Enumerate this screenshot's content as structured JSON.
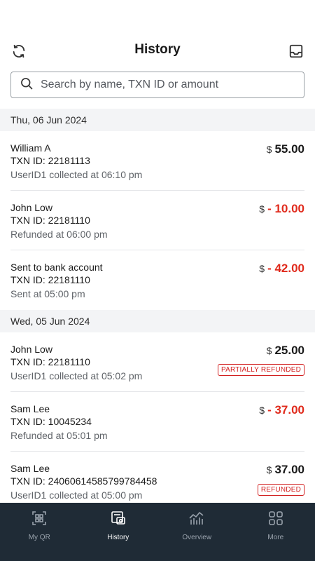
{
  "header": {
    "title": "History",
    "refresh_icon": "refresh-icon",
    "inbox_icon": "inbox-icon"
  },
  "search": {
    "placeholder": "Search by name, TXN ID or amount",
    "value": ""
  },
  "groups": [
    {
      "date": "Thu, 06 Jun 2024",
      "transactions": [
        {
          "name": "William A",
          "txn_id": "TXN ID: 22181113",
          "status": "UserID1 collected at 06:10 pm",
          "currency": "$",
          "amount": "55.00",
          "negative": false,
          "badge": ""
        },
        {
          "name": "John Low",
          "txn_id": "TXN ID: 22181110",
          "status": "Refunded at 06:00 pm",
          "currency": "$",
          "amount": "- 10.00",
          "negative": true,
          "badge": ""
        },
        {
          "name": "Sent to bank account",
          "txn_id": "TXN ID: 22181110",
          "status": "Sent at 05:00 pm",
          "currency": "$",
          "amount": "- 42.00",
          "negative": true,
          "badge": ""
        }
      ]
    },
    {
      "date": "Wed, 05 Jun 2024",
      "transactions": [
        {
          "name": "John Low",
          "txn_id": "TXN ID: 22181110",
          "status": "UserID1 collected at 05:02 pm",
          "currency": "$",
          "amount": "25.00",
          "negative": false,
          "badge": "PARTIALLY REFUNDED"
        },
        {
          "name": "Sam Lee",
          "txn_id": "TXN ID: 10045234",
          "status": "Refunded at 05:01 pm",
          "currency": "$",
          "amount": "- 37.00",
          "negative": true,
          "badge": ""
        },
        {
          "name": "Sam Lee",
          "txn_id": "TXN ID: 24060614585799784458",
          "status": "UserID1 collected at 05:00 pm",
          "currency": "$",
          "amount": "37.00",
          "negative": false,
          "badge": "REFUNDED"
        }
      ]
    }
  ],
  "tabbar": {
    "tabs": [
      {
        "label": "My QR",
        "icon": "qr-code-icon",
        "active": false
      },
      {
        "label": "History",
        "icon": "history-receipt-icon",
        "active": true
      },
      {
        "label": "Overview",
        "icon": "chart-icon",
        "active": false
      },
      {
        "label": "More",
        "icon": "grid-icon",
        "active": false
      }
    ]
  },
  "colors": {
    "negative": "#e02b1d",
    "tabbar_bg": "#1f2b36",
    "date_header_bg": "#f3f4f6",
    "badge": "#d21f1f"
  }
}
